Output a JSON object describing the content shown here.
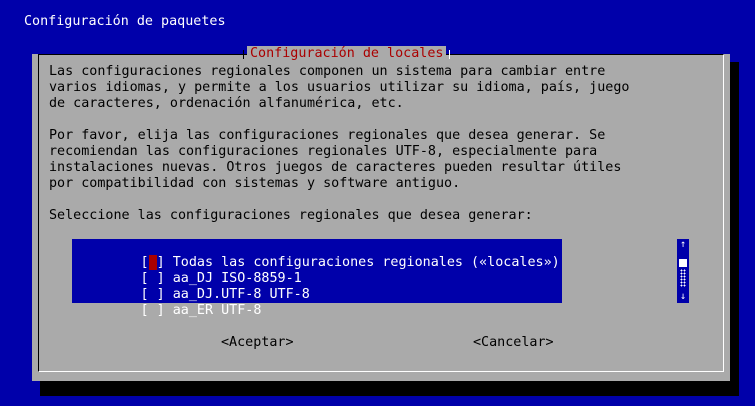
{
  "window": {
    "title": "Configuración de paquetes"
  },
  "dialog": {
    "title": "Configuración de locales",
    "paragraph1": [
      "Las configuraciones regionales componen un sistema para cambiar entre",
      "varios idiomas, y permite a los usuarios utilizar su idioma, país, juego",
      "de caracteres, ordenación alfanumérica, etc."
    ],
    "paragraph2": [
      "Por favor, elija las configuraciones regionales que desea generar. Se",
      "recomiendan las configuraciones regionales UTF-8, especialmente para",
      "instalaciones nuevas. Otros juegos de caracteres pueden resultar útiles",
      "por compatibilidad con sistemas y software antiguo."
    ],
    "prompt": "Seleccione las configuraciones regionales que desea generar:"
  },
  "locales_list": {
    "items": [
      {
        "checkbox": "[ ]",
        "label": "Todas las configuraciones regionales («locales»)",
        "checked": false,
        "focused": true
      },
      {
        "checkbox": "[ ]",
        "label": "aa_DJ ISO-8859-1",
        "checked": false,
        "focused": false
      },
      {
        "checkbox": "[ ]",
        "label": "aa_DJ.UTF-8 UTF-8",
        "checked": false,
        "focused": false
      },
      {
        "checkbox": "[ ]",
        "label": "aa_ER UTF-8",
        "checked": false,
        "focused": false
      }
    ]
  },
  "scrollbar": {
    "up_arrow": "↑",
    "down_arrow": "↓"
  },
  "buttons": {
    "accept": "<Aceptar>",
    "cancel": "<Cancelar>"
  },
  "colors": {
    "background": "#0000aa",
    "dialog": "#aaaaaa",
    "title_text": "#aa0000",
    "list_background": "#0000aa",
    "cursor": "#aa0000"
  }
}
